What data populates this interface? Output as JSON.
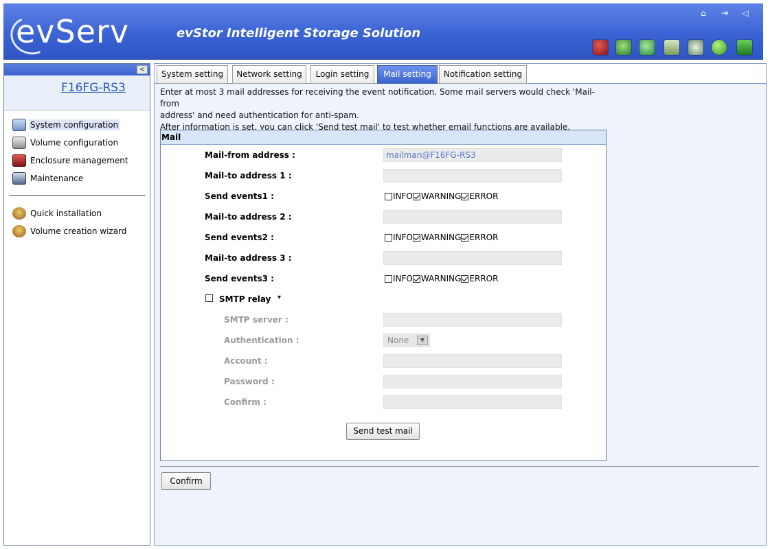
{
  "header": {
    "logo_text": "evServ",
    "app_title": "evStor Intelligent Storage Solution",
    "top_icons": [
      "home-icon",
      "logout-icon",
      "sound-icon"
    ],
    "status_icons": [
      "storage-warning-icon",
      "bottle-icon",
      "recycle-icon",
      "disk-icon",
      "fan-icon",
      "power-icon",
      "chip-icon"
    ]
  },
  "sidebar": {
    "collapse_label": "<",
    "device_name": "F16FG-RS3",
    "items": [
      {
        "label": "System configuration",
        "icon": "system-config-icon"
      },
      {
        "label": "Volume configuration",
        "icon": "volume-config-icon"
      },
      {
        "label": "Enclosure management",
        "icon": "enclosure-icon"
      },
      {
        "label": "Maintenance",
        "icon": "maintenance-icon"
      }
    ],
    "tools": [
      {
        "label": "Quick installation",
        "icon": "quick-install-icon"
      },
      {
        "label": "Volume creation wizard",
        "icon": "wizard-icon"
      }
    ]
  },
  "tabs": [
    {
      "label": "System setting"
    },
    {
      "label": "Network setting"
    },
    {
      "label": "Login setting"
    },
    {
      "label": "Mail setting"
    },
    {
      "label": "Notification setting"
    }
  ],
  "intro": {
    "line1": "Enter at most 3 mail addresses for receiving the event notification. Some mail servers would check 'Mail-from",
    "line2": "address' and need authentication for anti-spam.",
    "line3": "After information is set, you can click 'Send test mail' to test whether email functions are available."
  },
  "mail": {
    "section_title": "Mail",
    "from_label": "Mail-from address :",
    "from_value": "mailman@F16FG-RS3",
    "to1_label": "Mail-to address 1 :",
    "to1_value": "",
    "events1_label": "Send events1 :",
    "to2_label": "Mail-to address 2 :",
    "to2_value": "",
    "events2_label": "Send events2 :",
    "to3_label": "Mail-to address 3 :",
    "to3_value": "",
    "events3_label": "Send events3 :",
    "event_info": "INFO",
    "event_warning": "WARNING",
    "event_error": "ERROR",
    "smtp_relay_label": "SMTP relay",
    "smtp_server_label": "SMTP server :",
    "auth_label": "Authentication :",
    "auth_value": "None",
    "account_label": "Account :",
    "password_label": "Password :",
    "confirm_label": "Confirm :",
    "test_button": "Send test mail"
  },
  "confirm_button": "Confirm"
}
